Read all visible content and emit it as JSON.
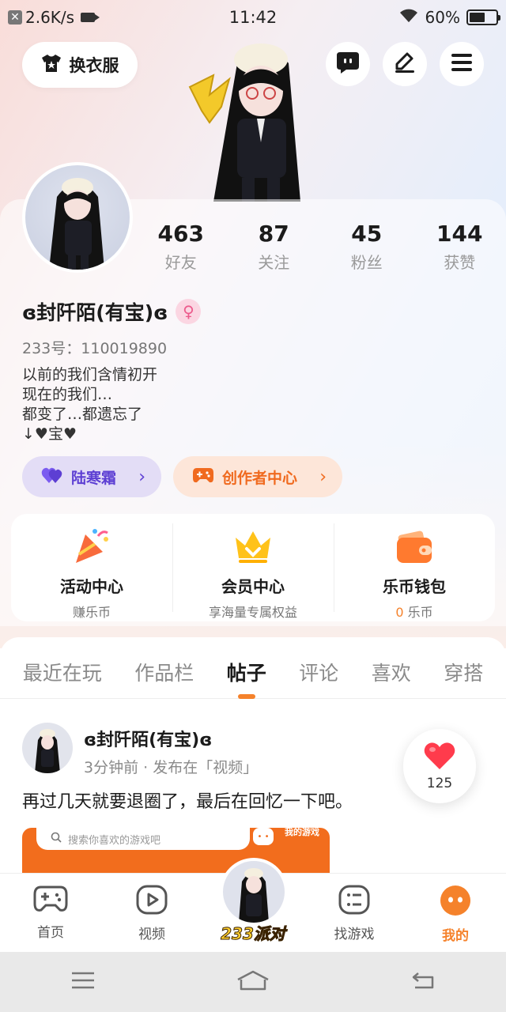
{
  "status_bar": {
    "network_speed": "2.6K/s",
    "time": "11:42",
    "battery": "60%",
    "battery_level": 0.6
  },
  "header": {
    "outfit_label": "换衣服",
    "icons": [
      "chat-icon",
      "edit-icon",
      "menu-icon"
    ]
  },
  "profile": {
    "stats": [
      {
        "value": "463",
        "label": "好友"
      },
      {
        "value": "87",
        "label": "关注"
      },
      {
        "value": "45",
        "label": "粉丝"
      },
      {
        "value": "144",
        "label": "获赞"
      }
    ],
    "nickname": "ɞ封阡陌(有宝)ɞ",
    "gender_symbol": "♀",
    "account_id": "233号：110019890",
    "bio_lines": [
      "以前的我们含情初开",
      "现在的我们…",
      "都变了…都遗忘了",
      "↓♥宝♥"
    ],
    "pills": [
      {
        "label": "陆寒霜",
        "color": "#5d3fd3"
      },
      {
        "label": "创作者中心",
        "color": "#f06a1f"
      }
    ]
  },
  "services": [
    {
      "title": "活动中心",
      "subtitle": "赚乐币"
    },
    {
      "title": "会员中心",
      "subtitle": "享海量专属权益"
    },
    {
      "title": "乐币钱包",
      "subtitle_value": "0",
      "subtitle": "乐币"
    }
  ],
  "tabs": [
    {
      "label": "最近在玩",
      "active": false
    },
    {
      "label": "作品栏",
      "active": false
    },
    {
      "label": "帖子",
      "active": true
    },
    {
      "label": "评论",
      "active": false
    },
    {
      "label": "喜欢",
      "active": false
    },
    {
      "label": "穿搭",
      "active": false
    }
  ],
  "post": {
    "author": "ɞ封阡陌(有宝)ɞ",
    "meta": "3分钟前 · 发布在「视频」",
    "text": "再过几天就要退圈了，最后在回忆一下吧。",
    "likes": "125",
    "media": {
      "search_placeholder": "搜索你喜欢的游戏吧",
      "game_label": "我的游戏"
    }
  },
  "bottom_nav": [
    {
      "label": "首页",
      "icon": "gamepad-icon"
    },
    {
      "label": "视频",
      "icon": "play-icon"
    },
    {
      "label": "233派对",
      "icon": "party-avatar"
    },
    {
      "label": "找游戏",
      "icon": "list-icon"
    },
    {
      "label": "我的",
      "icon": "smile-icon",
      "active": true
    }
  ],
  "colors": {
    "accent": "#f5822b",
    "purple": "#5d3fd3"
  }
}
